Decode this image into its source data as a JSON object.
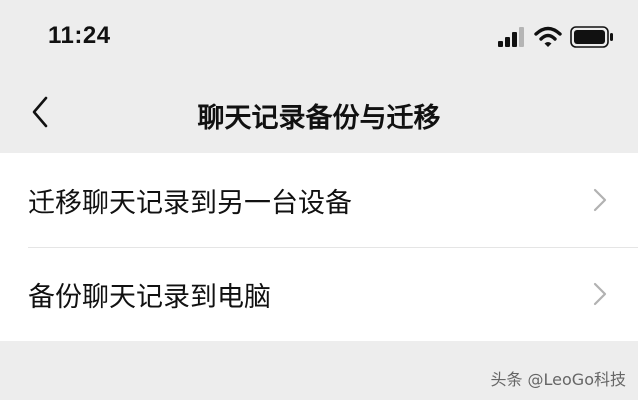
{
  "status_bar": {
    "time": "11:24",
    "icons": [
      "signal-icon",
      "wifi-icon",
      "battery-icon"
    ]
  },
  "nav": {
    "back_icon": "chevron-left-icon",
    "title": "聊天记录备份与迁移"
  },
  "list": {
    "items": [
      {
        "label": "迁移聊天记录到另一台设备",
        "icon": "chevron-right-icon"
      },
      {
        "label": "备份聊天记录到电脑",
        "icon": "chevron-right-icon"
      }
    ]
  },
  "watermark": "头条 @LeoGo科技",
  "colors": {
    "background": "#ededed",
    "list_background": "#ffffff",
    "text": "#111111",
    "chevron": "#b2b2b2"
  }
}
